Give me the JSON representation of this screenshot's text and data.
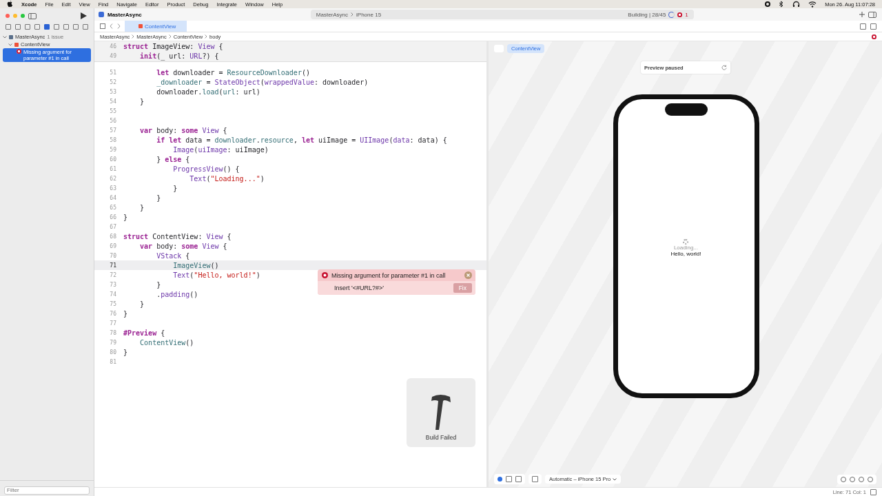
{
  "menubar": {
    "app": "Xcode",
    "menus": [
      "File",
      "Edit",
      "View",
      "Find",
      "Navigate",
      "Editor",
      "Product",
      "Debug",
      "Integrate",
      "Window",
      "Help"
    ],
    "clock": "Mon 26. Aug  11:07:28"
  },
  "toolbar": {
    "project": "MasterAsync",
    "scheme": "MasterAsync",
    "destination": "iPhone 15",
    "status": "Building | 28/45",
    "error_count": "1"
  },
  "navigator": {
    "project": "MasterAsync",
    "issue_count": "1 issue",
    "file": "ContentView",
    "issue": {
      "text": "Missing argument for parameter #1 in call",
      "selected": true
    },
    "filter_placeholder": "Filter"
  },
  "editor": {
    "tab": {
      "label": "ContentView",
      "selected": true
    },
    "breadcrumbs": [
      "MasterAsync",
      "MasterAsync",
      "ContentView",
      "body"
    ],
    "sticky": [
      {
        "no": "46",
        "tokens": [
          {
            "text": "struct ",
            "kind": "kw"
          },
          {
            "text": "ImageView",
            "kind": "plain"
          },
          {
            "text": ": ",
            "kind": "plain"
          },
          {
            "text": "View",
            "kind": "type"
          },
          {
            "text": " {",
            "kind": "plain"
          }
        ]
      },
      {
        "no": "49",
        "tokens": [
          {
            "text": "    init",
            "kind": "kw"
          },
          {
            "text": "(_ url: ",
            "kind": "plain"
          },
          {
            "text": "URL",
            "kind": "type"
          },
          {
            "text": "?) {",
            "kind": "plain"
          }
        ]
      }
    ],
    "lines": [
      {
        "no": "51",
        "current": false,
        "tokens": [
          {
            "text": "        let ",
            "kind": "kw"
          },
          {
            "text": "downloader = ",
            "kind": "plain"
          },
          {
            "text": "ResourceDownloader",
            "kind": "proj"
          },
          {
            "text": "()",
            "kind": "plain"
          }
        ]
      },
      {
        "no": "52",
        "current": false,
        "tokens": [
          {
            "text": "        _downloader",
            "kind": "proj"
          },
          {
            "text": " = ",
            "kind": "plain"
          },
          {
            "text": "StateObject",
            "kind": "type"
          },
          {
            "text": "(",
            "kind": "plain"
          },
          {
            "text": "wrappedValue",
            "kind": "type"
          },
          {
            "text": ": downloader)",
            "kind": "plain"
          }
        ]
      },
      {
        "no": "53",
        "current": false,
        "tokens": [
          {
            "text": "        downloader.",
            "kind": "plain"
          },
          {
            "text": "load",
            "kind": "proj"
          },
          {
            "text": "(",
            "kind": "plain"
          },
          {
            "text": "url",
            "kind": "proj"
          },
          {
            "text": ": url)",
            "kind": "plain"
          }
        ]
      },
      {
        "no": "54",
        "current": false,
        "tokens": [
          {
            "text": "    }",
            "kind": "plain"
          }
        ]
      },
      {
        "no": "55",
        "current": false
      },
      {
        "no": "56",
        "current": false
      },
      {
        "no": "57",
        "current": false,
        "tokens": [
          {
            "text": "    var ",
            "kind": "kw"
          },
          {
            "text": "body: ",
            "kind": "plain"
          },
          {
            "text": "some ",
            "kind": "kw"
          },
          {
            "text": "View",
            "kind": "type"
          },
          {
            "text": " {",
            "kind": "plain"
          }
        ]
      },
      {
        "no": "58",
        "current": false,
        "tokens": [
          {
            "text": "        if let ",
            "kind": "kw"
          },
          {
            "text": "data = ",
            "kind": "plain"
          },
          {
            "text": "downloader",
            "kind": "proj"
          },
          {
            "text": ".",
            "kind": "plain"
          },
          {
            "text": "resource",
            "kind": "proj"
          },
          {
            "text": ", ",
            "kind": "plain"
          },
          {
            "text": "let ",
            "kind": "kw"
          },
          {
            "text": "uiImage = ",
            "kind": "plain"
          },
          {
            "text": "UIImage",
            "kind": "type"
          },
          {
            "text": "(",
            "kind": "plain"
          },
          {
            "text": "data",
            "kind": "type"
          },
          {
            "text": ": data) {",
            "kind": "plain"
          }
        ]
      },
      {
        "no": "59",
        "current": false,
        "tokens": [
          {
            "text": "            Image",
            "kind": "type"
          },
          {
            "text": "(",
            "kind": "plain"
          },
          {
            "text": "uiImage",
            "kind": "type"
          },
          {
            "text": ": uiImage)",
            "kind": "plain"
          }
        ]
      },
      {
        "no": "60",
        "current": false,
        "tokens": [
          {
            "text": "        } ",
            "kind": "plain"
          },
          {
            "text": "else",
            "kind": "kw"
          },
          {
            "text": " {",
            "kind": "plain"
          }
        ]
      },
      {
        "no": "61",
        "current": false,
        "tokens": [
          {
            "text": "            ProgressView",
            "kind": "type"
          },
          {
            "text": "() {",
            "kind": "plain"
          }
        ]
      },
      {
        "no": "62",
        "current": false,
        "tokens": [
          {
            "text": "                Text",
            "kind": "type"
          },
          {
            "text": "(",
            "kind": "plain"
          },
          {
            "text": "\"Loading...\"",
            "kind": "str"
          },
          {
            "text": ")",
            "kind": "plain"
          }
        ]
      },
      {
        "no": "63",
        "current": false,
        "tokens": [
          {
            "text": "            }",
            "kind": "plain"
          }
        ]
      },
      {
        "no": "64",
        "current": false,
        "tokens": [
          {
            "text": "        }",
            "kind": "plain"
          }
        ]
      },
      {
        "no": "65",
        "current": false,
        "tokens": [
          {
            "text": "    }",
            "kind": "plain"
          }
        ]
      },
      {
        "no": "66",
        "current": false,
        "tokens": [
          {
            "text": "}",
            "kind": "plain"
          }
        ]
      },
      {
        "no": "67",
        "current": false
      },
      {
        "no": "68",
        "current": false,
        "tokens": [
          {
            "text": "struct ",
            "kind": "kw"
          },
          {
            "text": "ContentView",
            "kind": "plain"
          },
          {
            "text": ": ",
            "kind": "plain"
          },
          {
            "text": "View",
            "kind": "type"
          },
          {
            "text": " {",
            "kind": "plain"
          }
        ]
      },
      {
        "no": "69",
        "current": false,
        "tokens": [
          {
            "text": "    var ",
            "kind": "kw"
          },
          {
            "text": "body: ",
            "kind": "plain"
          },
          {
            "text": "some ",
            "kind": "kw"
          },
          {
            "text": "View",
            "kind": "type"
          },
          {
            "text": " {",
            "kind": "plain"
          }
        ]
      },
      {
        "no": "70",
        "current": false,
        "tokens": [
          {
            "text": "        VStack",
            "kind": "type"
          },
          {
            "text": " {",
            "kind": "plain"
          }
        ]
      },
      {
        "no": "71",
        "current": true,
        "tokens": [
          {
            "text": "            ImageView",
            "kind": "proj"
          },
          {
            "text": "()",
            "kind": "plain"
          }
        ]
      },
      {
        "no": "72",
        "current": false,
        "tokens": [
          {
            "text": "            Text",
            "kind": "type"
          },
          {
            "text": "(",
            "kind": "plain"
          },
          {
            "text": "\"Hello, world!\"",
            "kind": "str"
          },
          {
            "text": ")",
            "kind": "plain"
          }
        ]
      },
      {
        "no": "73",
        "current": false,
        "tokens": [
          {
            "text": "        }",
            "kind": "plain"
          }
        ]
      },
      {
        "no": "74",
        "current": false,
        "tokens": [
          {
            "text": "        .",
            "kind": "plain"
          },
          {
            "text": "padding",
            "kind": "type"
          },
          {
            "text": "()",
            "kind": "plain"
          }
        ]
      },
      {
        "no": "75",
        "current": false,
        "tokens": [
          {
            "text": "    }",
            "kind": "plain"
          }
        ]
      },
      {
        "no": "76",
        "current": false,
        "tokens": [
          {
            "text": "}",
            "kind": "plain"
          }
        ]
      },
      {
        "no": "77",
        "current": false
      },
      {
        "no": "78",
        "current": false,
        "tokens": [
          {
            "text": "#Preview",
            "kind": "kw"
          },
          {
            "text": " {",
            "kind": "plain"
          }
        ]
      },
      {
        "no": "79",
        "current": false,
        "tokens": [
          {
            "text": "    ContentView",
            "kind": "proj"
          },
          {
            "text": "()",
            "kind": "plain"
          }
        ]
      },
      {
        "no": "80",
        "current": false,
        "tokens": [
          {
            "text": "}",
            "kind": "plain"
          }
        ]
      },
      {
        "no": "81",
        "current": false
      }
    ],
    "error": {
      "message": "Missing argument for parameter #1 in call",
      "fix_text": "Insert '<#URL?#>'",
      "fix_button": "Fix"
    },
    "hud": {
      "text": "Build Failed"
    }
  },
  "canvas": {
    "chip": "ContentView",
    "banner": "Preview paused",
    "loading": "Loading...",
    "hello": "Hello, world!",
    "device": "Automatic – iPhone 15 Pro"
  },
  "status_bar": {
    "position": "Line: 71  Col: 1"
  }
}
